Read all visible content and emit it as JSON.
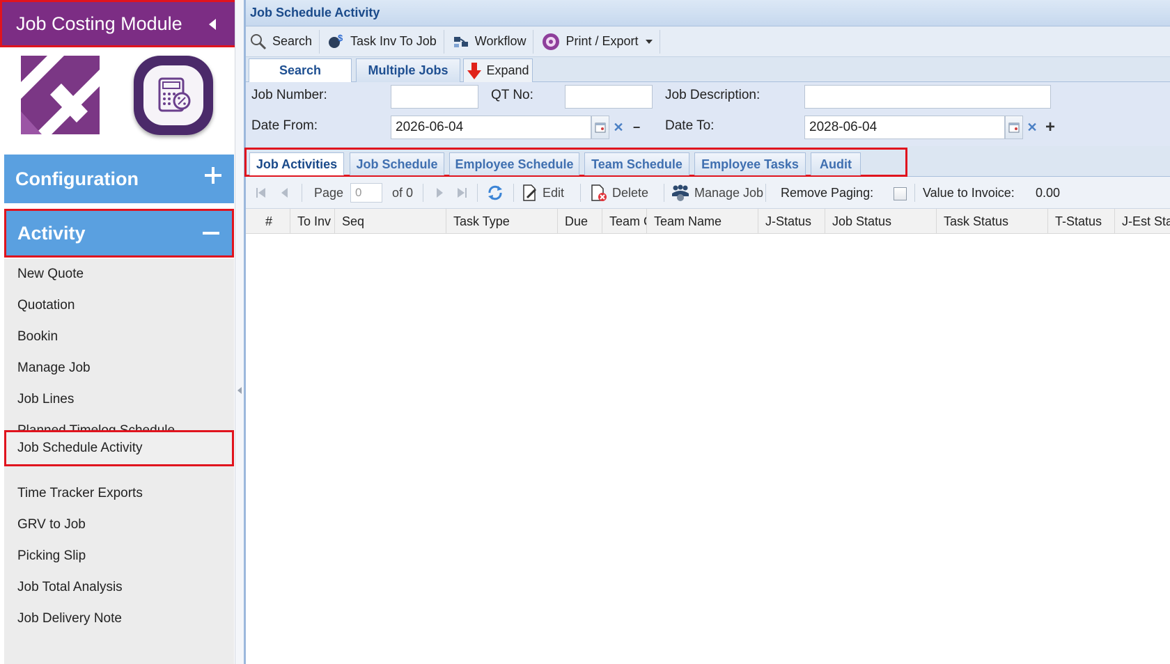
{
  "sidebar": {
    "module_title": "Job Costing Module",
    "sections": {
      "configuration": "Configuration",
      "activity": "Activity"
    },
    "menu_items": [
      "New Quote",
      "Quotation",
      "Bookin",
      "Manage Job",
      "Job Lines",
      "Planned Timelog Schedule",
      "Job Schedule Activity",
      "Time Tracker Exports",
      "GRV to Job",
      "Picking Slip",
      "Job Total Analysis",
      "Job Delivery Note"
    ],
    "active_item": "Job Schedule Activity"
  },
  "main": {
    "title": "Job Schedule Activity",
    "toolbar": {
      "search": "Search",
      "task_inv": "Task Inv To Job",
      "workflow": "Workflow",
      "print_export": "Print / Export"
    },
    "search_tabs": {
      "search": "Search",
      "multiple_jobs": "Multiple Jobs",
      "expand": "Expand"
    },
    "form": {
      "job_number_label": "Job Number:",
      "job_number_value": "",
      "qt_no_label": "QT No:",
      "qt_no_value": "",
      "job_description_label": "Job Description:",
      "job_description_value": "",
      "date_from_label": "Date From:",
      "date_from_value": "2026-06-04",
      "date_to_label": "Date To:",
      "date_to_value": "2028-06-04"
    },
    "tabs": [
      "Job Activities",
      "Job Schedule",
      "Employee Schedule",
      "Team Schedule",
      "Employee Tasks",
      "Audit"
    ],
    "active_tab": "Job Activities",
    "grid_toolbar": {
      "page_label": "Page",
      "page_value": "0",
      "of_label": "of 0",
      "edit": "Edit",
      "delete": "Delete",
      "manage_job": "Manage Job",
      "remove_paging": "Remove Paging:",
      "value_to_invoice_label": "Value to Invoice:",
      "value_to_invoice": "0.00"
    },
    "columns": [
      "#",
      "To Inv",
      "Seq",
      "Task Type",
      "Due",
      "Team C",
      "Team Name",
      "J-Status",
      "Job Status",
      "Task Status",
      "T-Status",
      "J-Est Sta"
    ]
  },
  "colors": {
    "module_header": "#7c2d84",
    "section_header": "#5aa0e0",
    "highlight_border": "#e0141e",
    "tab_text": "#3f6fb0",
    "title_text": "#1a4a8a"
  }
}
